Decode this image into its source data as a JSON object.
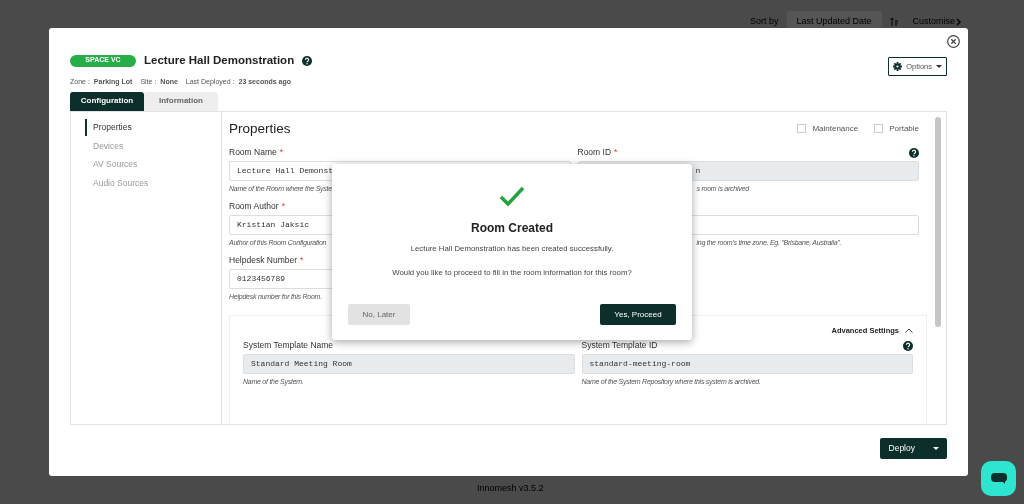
{
  "background": {
    "sort_label": "Sort by",
    "sort_field": "Last Updated Date",
    "customise_link": "Customise",
    "footer": "Innomesh v3.5.2"
  },
  "modal": {
    "badge": "SPACE VC",
    "title": "Lecture Hall Demonstration",
    "meta": [
      {
        "label": "Zone :",
        "value": "Parking Lot"
      },
      {
        "label": "Site :",
        "value": "None"
      },
      {
        "label": "Last Deployed :",
        "value": "23 seconds ago"
      }
    ],
    "options_button": "Options",
    "tabs": [
      {
        "label": "Configuration",
        "selected": true
      },
      {
        "label": "Information",
        "selected": false
      }
    ],
    "sidebar": [
      {
        "label": "Properties",
        "selected": true
      },
      {
        "label": "Devices",
        "selected": false
      },
      {
        "label": "AV Sources",
        "selected": false
      },
      {
        "label": "Audio Sources",
        "selected": false
      }
    ],
    "heading": "Properties",
    "checkboxes": [
      {
        "label": "Maintenance",
        "checked": false
      },
      {
        "label": "Portable",
        "checked": false
      }
    ],
    "field_rows": [
      [
        {
          "label": "Room Name",
          "required_mark": "*",
          "value": "Lecture Hall Demonst",
          "hint": "Name of the Room where the Syste",
          "readonly": false
        },
        {
          "label": "Room ID",
          "required_mark": "*",
          "value": "n",
          "hint": "s room is archived",
          "readonly": true,
          "help": true
        }
      ],
      [
        {
          "label": "Room Author",
          "required_mark": "*",
          "value": "Kristian Jaksic",
          "hint": "Author of this Room Configuration",
          "readonly": false
        },
        {
          "hint": "ing the room's time zone. Eg. \"Brisbane, Australia\".",
          "readonly": false
        }
      ],
      [
        {
          "label": "Helpdesk Number",
          "required_mark": "*",
          "value": "0123456789",
          "hint": "Helpdesk number for this Room.",
          "readonly": false
        }
      ]
    ],
    "advanced": {
      "label": "Advanced Settings",
      "expanded": true,
      "fields": [
        {
          "label": "System Template Name",
          "value": "Standard Meeting Room",
          "hint": "Name of the System.",
          "readonly": true
        },
        {
          "label": "System Template ID",
          "value": "standard-meeting-room",
          "hint": "Name of the System Repository where this system is archived.",
          "readonly": true,
          "help": true
        }
      ]
    },
    "deploy_button": "Deploy"
  },
  "dialog": {
    "title": "Room Created",
    "message": "Lecture Hall Demonstration has been created successfully.",
    "question": "Would you like to proceed to fill in the room information for this room?",
    "buttons": [
      {
        "label": "No, Later",
        "kind": "secondary"
      },
      {
        "label": "Yes, Proceed",
        "kind": "primary"
      }
    ]
  }
}
